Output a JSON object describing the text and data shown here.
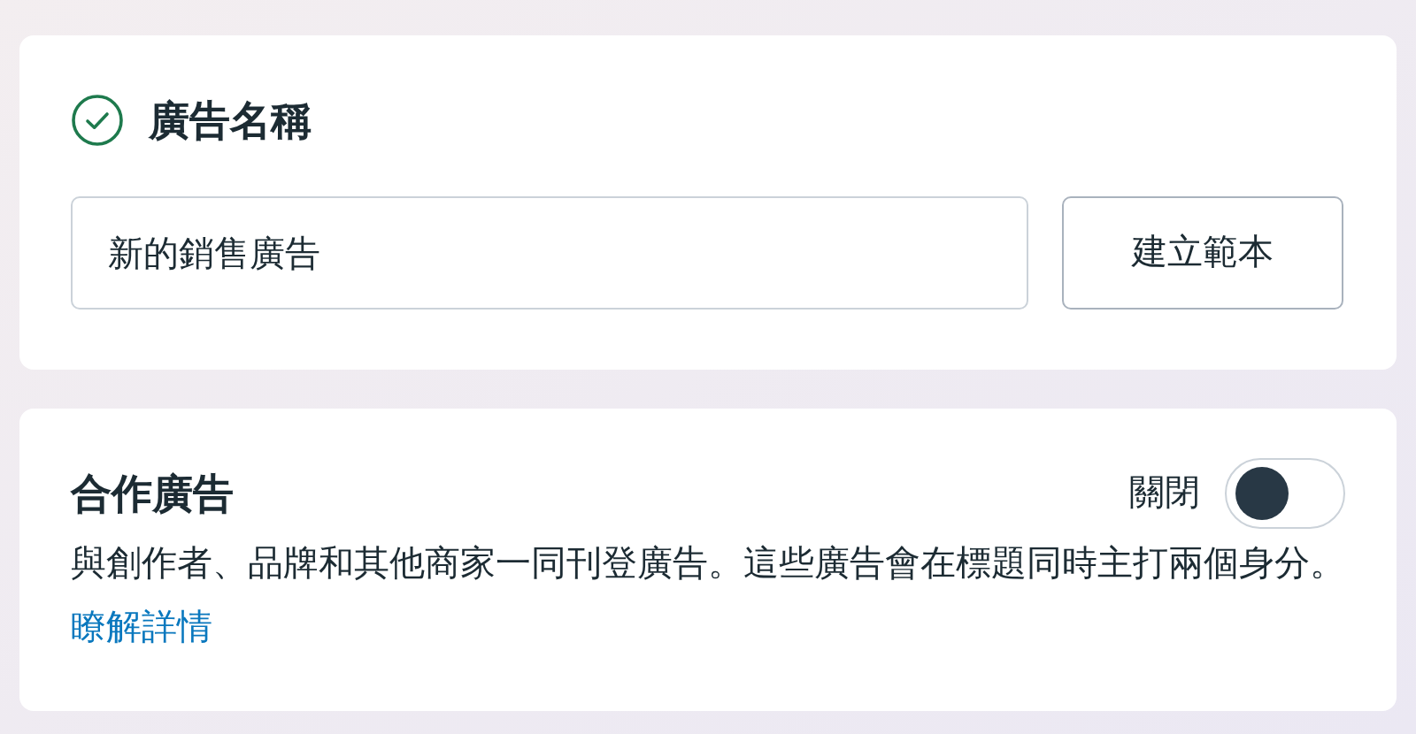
{
  "ad_name_section": {
    "title": "廣告名稱",
    "complete": true,
    "name_field": {
      "value": "新的銷售廣告"
    },
    "template_button": "建立範本"
  },
  "partnership_ad_section": {
    "title": "合作廣告",
    "toggle": {
      "label": "關閉",
      "on": false
    },
    "description": "與創作者、品牌和其他商家一同刊登廣告。這些廣告會在標題同時主打兩個身分。",
    "learn_more_link": "瞭解詳情"
  }
}
